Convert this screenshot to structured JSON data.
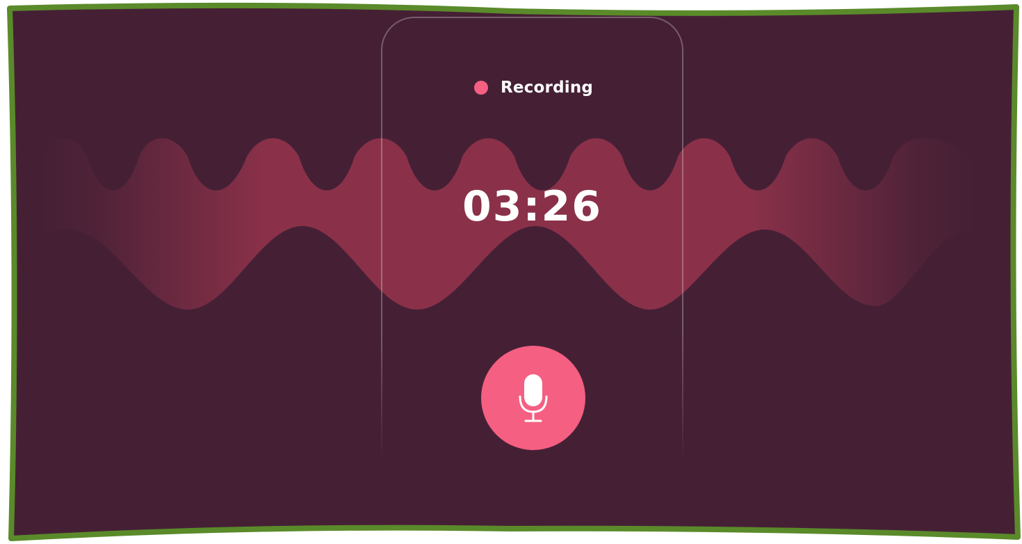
{
  "status": {
    "label": "Recording",
    "indicator_color": "#f45f82"
  },
  "timer": {
    "elapsed": "03:26"
  },
  "mic_button": {
    "icon": "microphone-icon",
    "color": "#f45f82"
  },
  "colors": {
    "background": "#452035",
    "frame_border": "#5a8a2a",
    "wave": "#8a3149"
  }
}
